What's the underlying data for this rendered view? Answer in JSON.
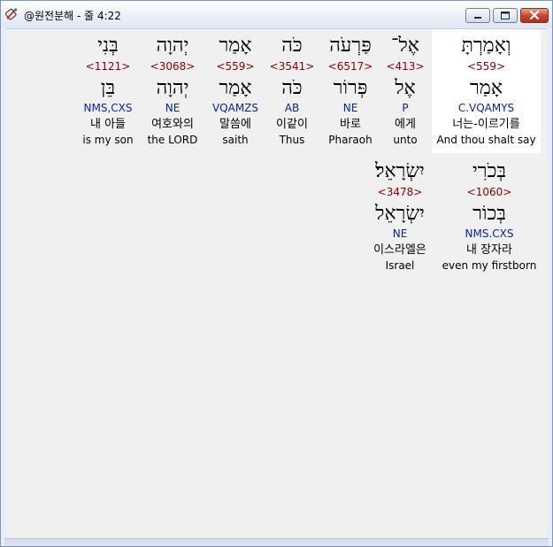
{
  "window": {
    "title": "@원전분해 - 줄 4:22"
  },
  "verse_words": [
    {
      "hebrew": "וְאָמַרְתָּ",
      "strong": "<559>",
      "root": "אָמַר",
      "morph": "C.VQAMYS",
      "korean": "너는-이르기를",
      "english": "And thou shalt say",
      "selected": true
    },
    {
      "hebrew": "אֶל־",
      "strong": "<413>",
      "root": "אֶל",
      "morph": "P",
      "korean": "에게",
      "english": "unto"
    },
    {
      "hebrew": "פַּרְעֹה",
      "strong": "<6517>",
      "root": "פְּרוֹר",
      "morph": "NE",
      "korean": "바로",
      "english": "Pharaoh"
    },
    {
      "hebrew": "כֹּה",
      "strong": "<3541>",
      "root": "כֹּה",
      "morph": "AB",
      "korean": "이같이",
      "english": "Thus"
    },
    {
      "hebrew": "אָמַר",
      "strong": "<559>",
      "root": "אָמַר",
      "morph": "VQAMZS",
      "korean": "말씀에",
      "english": "saith"
    },
    {
      "hebrew": "יְהוָה",
      "strong": "<3068>",
      "root": "יְהוָה",
      "morph": "NE",
      "korean": "여호와의",
      "english": "the LORD"
    },
    {
      "hebrew": "בְּנִי",
      "strong": "<1121>",
      "root": "בֵּן",
      "morph": "NMS,CXS",
      "korean": "내 아들",
      "english": "is my son"
    },
    {
      "hebrew": "בְּכֹרִי",
      "strong": "<1060>",
      "root": "בְּכוֹר",
      "morph": "NMS.CXS",
      "korean": "내 장자라",
      "english": "even my firstborn"
    },
    {
      "hebrew": "יִשְׂרָאֵל׃",
      "strong": "<3478>",
      "root": "יִשְׂרָאֵל",
      "morph": "NE",
      "korean": "이스라엘은",
      "english": "Israel"
    }
  ]
}
